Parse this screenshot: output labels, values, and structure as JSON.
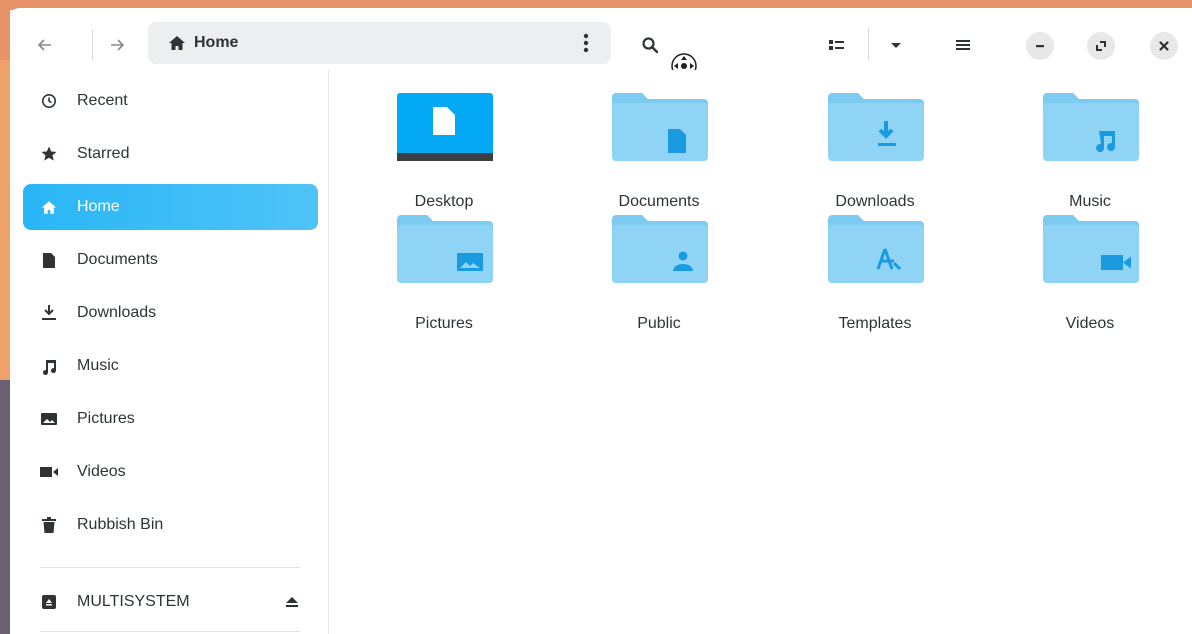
{
  "header": {
    "path": {
      "label": "Home",
      "icon": "home-icon"
    },
    "back_icon": "arrow-left-icon",
    "forward_icon": "arrow-right-icon",
    "menu_icon": "kebab-icon",
    "search_icon": "search-icon",
    "view_icon": "list-view-icon",
    "view_dropdown_icon": "chevron-down-icon",
    "main_menu_icon": "hamburger-icon",
    "window_controls": [
      "minimize-icon",
      "maximize-icon",
      "close-icon"
    ]
  },
  "sidebar": {
    "items": [
      {
        "label": "Recent",
        "icon": "clock-icon"
      },
      {
        "label": "Starred",
        "icon": "star-icon"
      },
      {
        "label": "Home",
        "icon": "home-icon",
        "active": true
      },
      {
        "label": "Documents",
        "icon": "document-icon"
      },
      {
        "label": "Downloads",
        "icon": "download-icon"
      },
      {
        "label": "Music",
        "icon": "music-icon"
      },
      {
        "label": "Pictures",
        "icon": "picture-icon"
      },
      {
        "label": "Videos",
        "icon": "video-icon"
      },
      {
        "label": "Rubbish Bin",
        "icon": "trash-icon"
      }
    ],
    "devices": [
      {
        "label": "MULTISYSTEM",
        "icon": "drive-icon",
        "action_icon": "eject-icon"
      }
    ]
  },
  "files": [
    {
      "name": "Desktop",
      "icon": "desktop-folder-icon"
    },
    {
      "name": "Documents",
      "icon": "documents-folder-icon"
    },
    {
      "name": "Downloads",
      "icon": "downloads-folder-icon"
    },
    {
      "name": "Music",
      "icon": "music-folder-icon"
    },
    {
      "name": "Pictures",
      "icon": "pictures-folder-icon"
    },
    {
      "name": "Public",
      "icon": "public-folder-icon"
    },
    {
      "name": "Templates",
      "icon": "templates-folder-icon"
    },
    {
      "name": "Videos",
      "icon": "videos-folder-icon"
    }
  ],
  "colors": {
    "accent": "#29b6f6",
    "folder": "#90d4f5",
    "folder_tab": "#7ecbf2",
    "folder_glyph": "#1a9be0",
    "desktop_blue": "#03a9f4"
  }
}
